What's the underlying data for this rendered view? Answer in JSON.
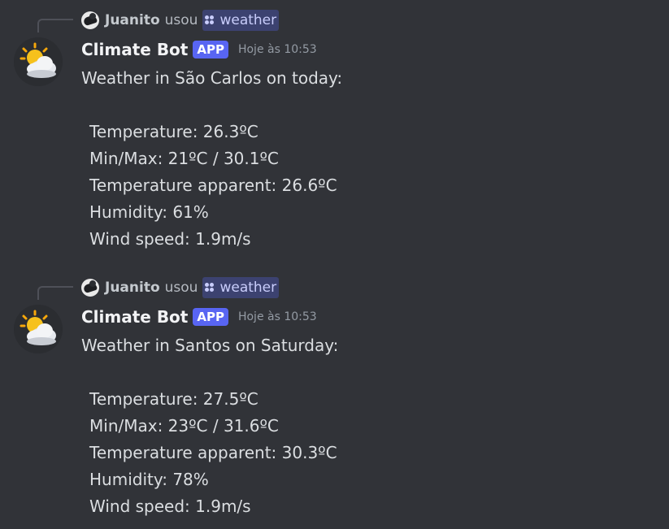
{
  "messages": [
    {
      "reply": {
        "user": "Juanito",
        "verb": "usou",
        "command": "weather"
      },
      "author": {
        "name": "Climate Bot",
        "badge": "APP",
        "timestamp": "Hoje às 10:53",
        "avatar_icon": "sun-behind-cloud-icon"
      },
      "intro": "Weather in São Carlos on today:",
      "lines": [
        "Temperature: 26.3ºC",
        "Min/Max: 21ºC / 30.1ºC",
        "Temperature apparent: 26.6ºC",
        "Humidity: 61%",
        "Wind speed: 1.9m/s"
      ]
    },
    {
      "reply": {
        "user": "Juanito",
        "verb": "usou",
        "command": "weather"
      },
      "author": {
        "name": "Climate Bot",
        "badge": "APP",
        "timestamp": "Hoje às 10:53",
        "avatar_icon": "sun-behind-cloud-icon"
      },
      "intro": "Weather in Santos on Saturday:",
      "lines": [
        "Temperature: 27.5ºC",
        "Min/Max: 23ºC / 31.6ºC",
        "Temperature apparent: 30.3ºC",
        "Humidity: 78%",
        "Wind speed: 1.9m/s"
      ]
    }
  ],
  "colors": {
    "background": "#313338",
    "app_badge": "#5865f2",
    "command_chip": "#3c4270",
    "text": "#dbdee1"
  }
}
